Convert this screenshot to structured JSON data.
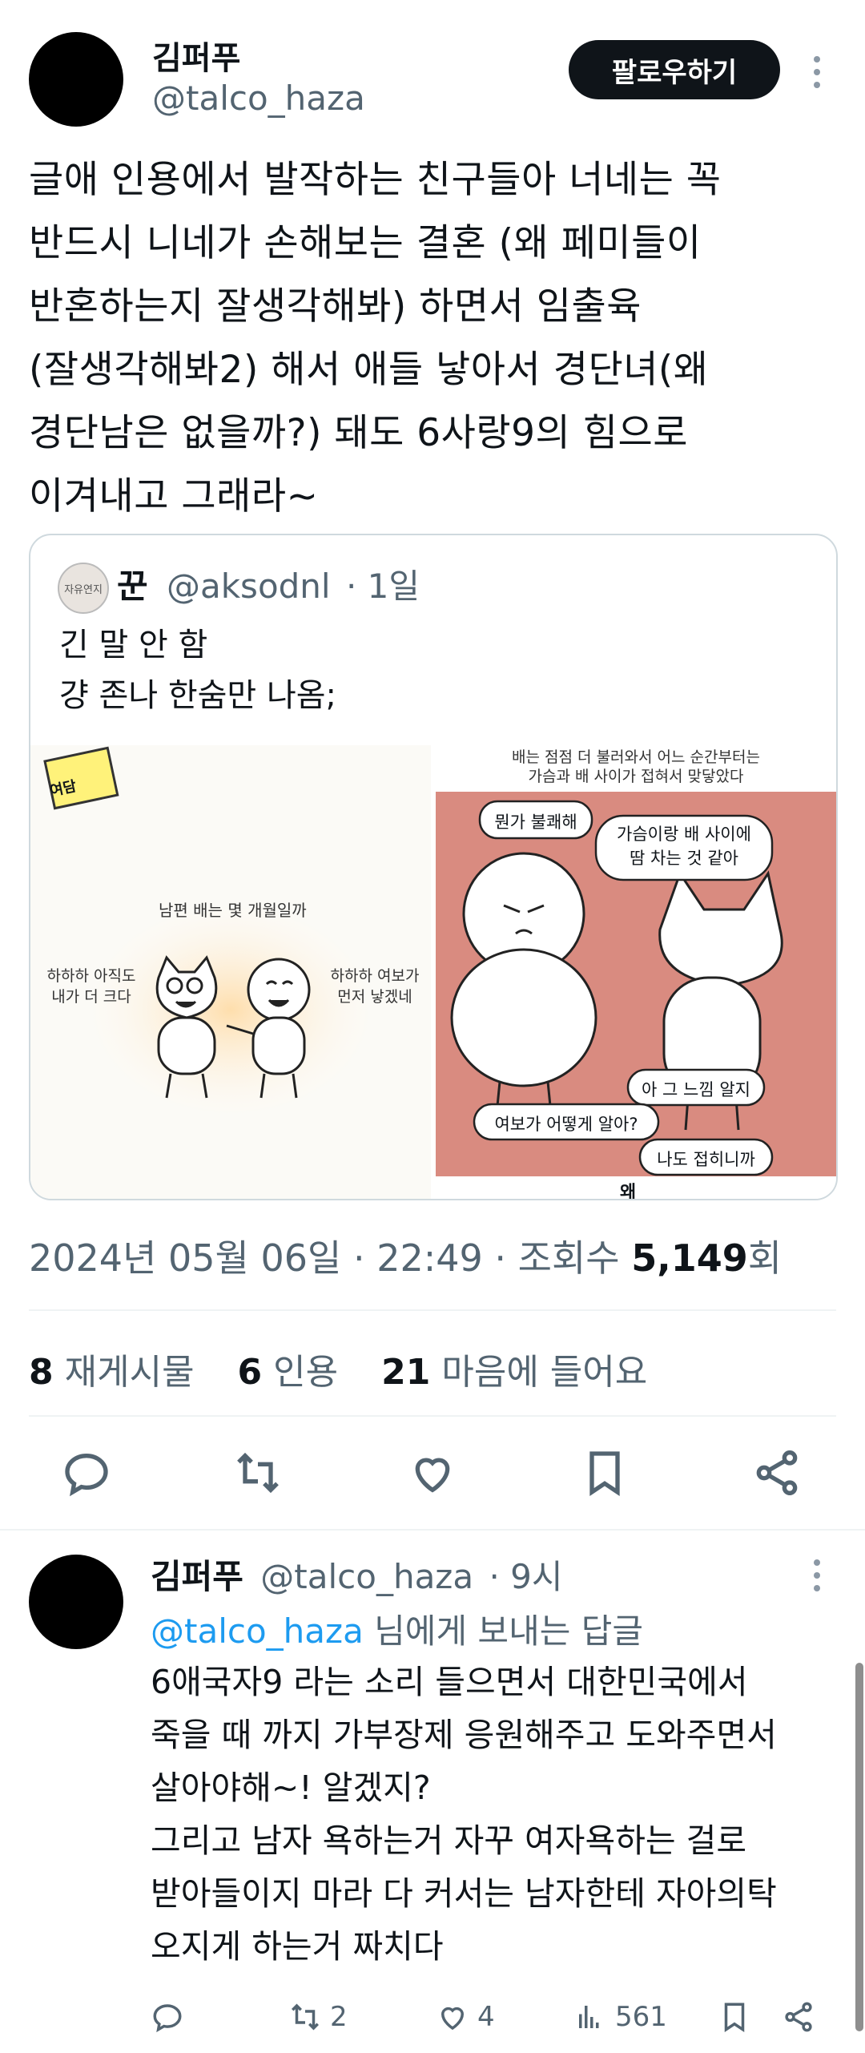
{
  "tweet": {
    "author_name": "김퍼푸",
    "author_handle": "@talco_haza",
    "follow_label": "팔로우하기",
    "text": "글애 인용에서 발작하는 친구들아 너네는 꼭\n반드시 니네가 손해보는 결혼 (왜 페미들이\n반혼하는지 잘생각해봐) 하면서 임출육\n(잘생각해봐2) 해서 애들 낳아서 경단녀(왜\n경단남은 없을까?) 돼도 6사랑9의 힘으로\n이겨내고 그래라~",
    "quote": {
      "avatar_text": "자유연지",
      "name": "꾼",
      "handle": "@aksodnl",
      "time": "· 1일",
      "text": "긴 말 안 함\n걍 존나 한숨만 나옴;",
      "comic_left": {
        "sticker": "여담",
        "caption": "남편 배는 몇 개월일까",
        "left_speech": "하하하 아직도\n내가 더 크다",
        "right_speech": "하하하 여보가\n먼저 낳겠네"
      },
      "comic_right": {
        "top_caption_1": "배는 점점 더 불러와서 어느 순간부터는",
        "top_caption_2": "가슴과 배 사이가 접혀서 맞닿았다",
        "bubble_1": "뭔가 불쾌해",
        "bubble_2": "가슴이랑 배 사이에\n땀 차는 것 같아",
        "bubble_3": "아 그 느낌 알지",
        "bubble_4": "여보가 어떻게 알아?",
        "bubble_5": "나도 접히니까",
        "bottom_cut": "왜"
      }
    },
    "meta": {
      "datetime": "2024년 05월 06일 · 22:49 · 조회수 ",
      "views": "5,149",
      "views_suffix": "회"
    },
    "stats": {
      "retweets_count": "8",
      "retweets_label": "재게시물",
      "quotes_count": "6",
      "quotes_label": "인용",
      "likes_count": "21",
      "likes_label": "마음에 들어요"
    }
  },
  "reply": {
    "author_name": "김퍼푸",
    "author_handle": "@talco_haza",
    "time": "· 9시",
    "reply_to_handle": "@talco_haza",
    "reply_to_suffix": " 님에게 보내는 답글",
    "text": "6애국자9 라는 소리 들으면서 대한민국에서\n죽을 때 까지 가부장제 응원해주고 도와주면서\n살아야해~! 알겠지?\n그리고 남자 욕하는거 자꾸 여자욕하는 걸로\n받아들이지 마라 다 커서는 남자한테 자아의탁\n오지게 하는거 짜치다",
    "retweets": "2",
    "likes": "4",
    "views": "561"
  },
  "colors": {
    "text": "#0f1419",
    "secondary": "#536471",
    "link": "#1d9bf0",
    "divider": "#eff3f4",
    "comic_bg_pink": "#d98b80"
  },
  "icons": [
    "more-icon",
    "reply-icon",
    "retweet-icon",
    "like-icon",
    "bookmark-icon",
    "share-icon",
    "views-icon"
  ]
}
